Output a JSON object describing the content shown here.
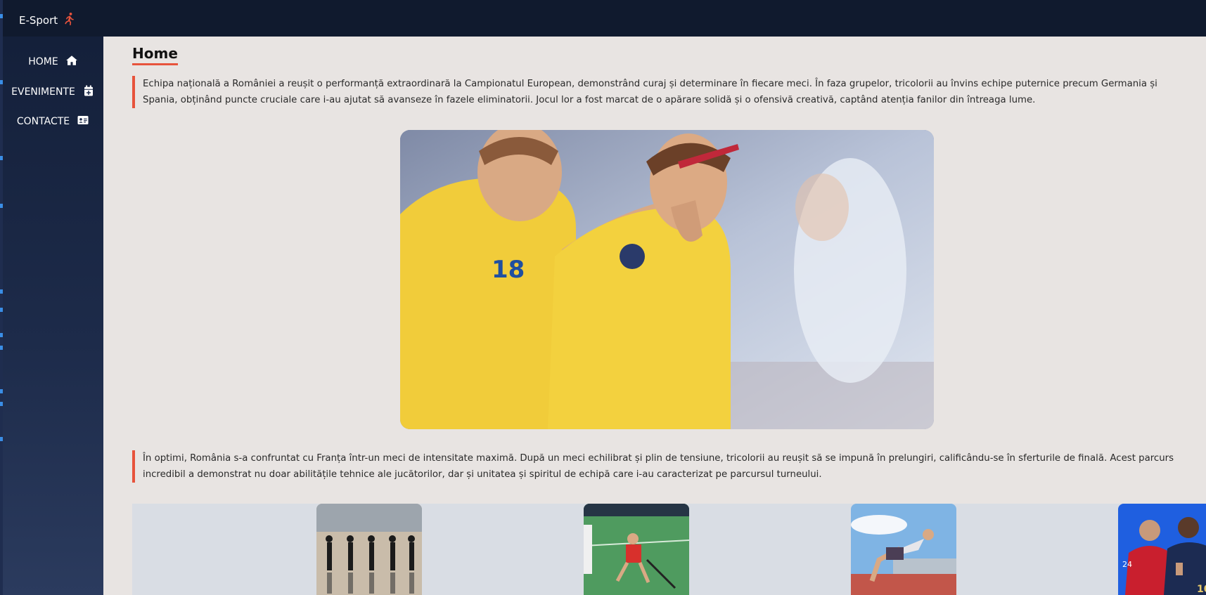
{
  "brand": {
    "name": "E-Sport",
    "icon": "running-person-icon"
  },
  "sidebar": {
    "items": [
      {
        "label": "HOME",
        "icon": "home-icon"
      },
      {
        "label": "EVENIMENTE",
        "icon": "calendar-plus-icon"
      },
      {
        "label": "CONTACTE",
        "icon": "contact-card-icon"
      }
    ]
  },
  "main": {
    "title": "Home",
    "paragraph1": "Echipa națională a României a reușit o performanță extraordinară la Campionatul European, demonstrând curaj și determinare în fiecare meci. În faza grupelor, tricolorii au învins echipe puternice precum Germania și Spania, obținând puncte cruciale care i-au ajutat să avanseze în fazele eliminatorii. Jocul lor a fost marcat de o apărare solidă și o ofensivă creativă, captând atenția fanilor din întreaga lume.",
    "paragraph2": "În optimi, România s-a confruntat cu Franța într-un meci de intensitate maximă. După un meci echilibrat și plin de tensiune, tricolorii au reușit să se impună în prelungiri, calificându-se în sferturile de finală. Acest parcurs incredibil a demonstrat nu doar abilitățile tehnice ale jucătorilor, dar și unitatea și spiritul de echipă care i-au caracterizat pe parcursul turneului."
  },
  "colors": {
    "accent": "#e7533c",
    "topbar": "#101a2e",
    "sidebar": "#1d2b4a",
    "background": "#e8e4e2"
  }
}
